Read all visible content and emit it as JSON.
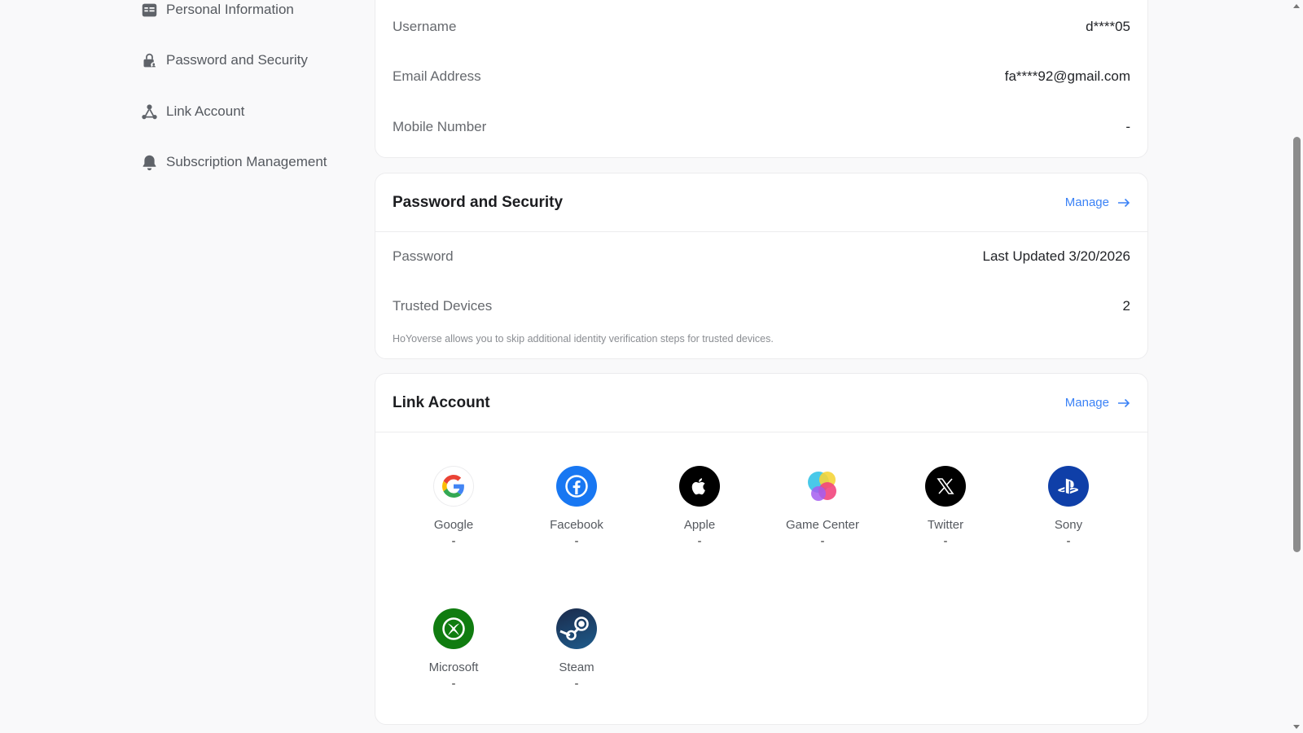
{
  "sidebar": {
    "items": [
      {
        "label": "Personal Information",
        "icon": "id-card-icon"
      },
      {
        "label": "Password and Security",
        "icon": "lock-person-icon"
      },
      {
        "label": "Link Account",
        "icon": "link-nodes-icon"
      },
      {
        "label": "Subscription Management",
        "icon": "bell-icon"
      }
    ]
  },
  "account": {
    "username_label": "Username",
    "username_value": "d****05",
    "email_label": "Email Address",
    "email_value": "fa****92@gmail.com",
    "mobile_label": "Mobile Number",
    "mobile_value": "-"
  },
  "security": {
    "title": "Password and Security",
    "manage_label": "Manage",
    "password_label": "Password",
    "password_value": "Last Updated 3/20/2026",
    "devices_label": "Trusted Devices",
    "devices_value": "2",
    "devices_note": "HoYoverse allows you to skip additional identity verification steps for trusted devices."
  },
  "link_account": {
    "title": "Link Account",
    "manage_label": "Manage",
    "providers": [
      {
        "name": "Google",
        "status": "-",
        "icon": "google-icon"
      },
      {
        "name": "Facebook",
        "status": "-",
        "icon": "facebook-icon"
      },
      {
        "name": "Apple",
        "status": "-",
        "icon": "apple-icon"
      },
      {
        "name": "Game Center",
        "status": "-",
        "icon": "game-center-icon"
      },
      {
        "name": "Twitter",
        "status": "-",
        "icon": "x-icon"
      },
      {
        "name": "Sony",
        "status": "-",
        "icon": "playstation-icon"
      },
      {
        "name": "Microsoft",
        "status": "-",
        "icon": "xbox-icon"
      },
      {
        "name": "Steam",
        "status": "-",
        "icon": "steam-icon"
      }
    ]
  },
  "colors": {
    "accent": "#3b82f6",
    "facebook": "#1877f2",
    "apple": "#000000",
    "twitter": "#000000",
    "sony": "#0f3fa8",
    "microsoft": "#107c10",
    "steam": "#1b2838"
  }
}
